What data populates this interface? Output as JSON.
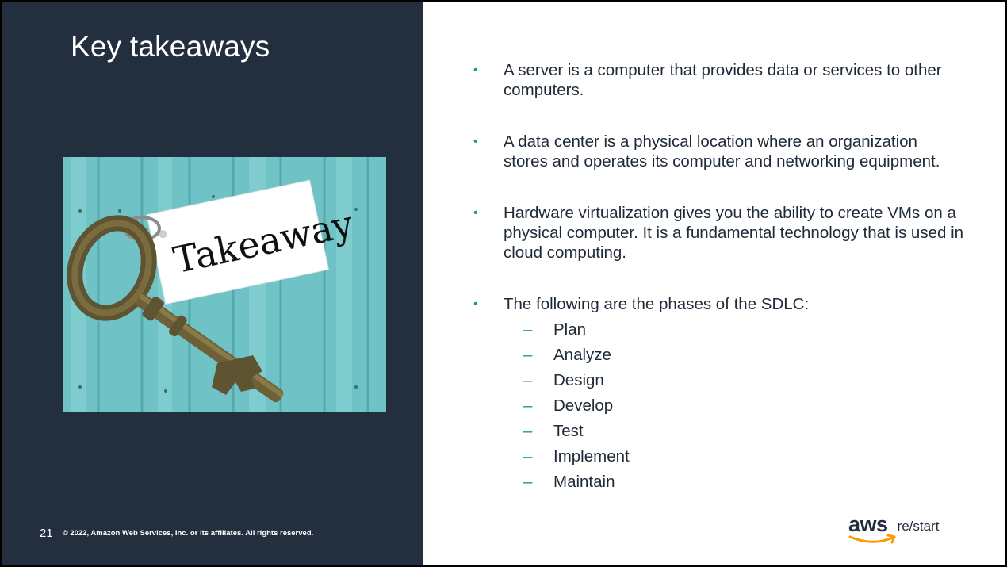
{
  "slide": {
    "title": "Key takeaways",
    "page_number": "21",
    "copyright": "© 2022, Amazon Web Services, Inc. or its affiliates. All rights reserved.",
    "image": {
      "tag_text": "Takeaway",
      "icon": "key-with-tag-image"
    }
  },
  "bullets": [
    {
      "text": "A server is a computer that provides data or services to other computers."
    },
    {
      "text": "A data center is a physical location where an organization stores and operates its computer and networking equipment."
    },
    {
      "text": "Hardware virtualization gives you the ability to create VMs on a physical computer. It is a fundamental technology that is used in cloud computing."
    },
    {
      "text": "The following are the phases of the SDLC:"
    }
  ],
  "bullet_marker": "•",
  "sub_marker": "–",
  "sdlc_phases": [
    "Plan",
    "Analyze",
    "Design",
    "Develop",
    "Test",
    "Implement",
    "Maintain"
  ],
  "logo": {
    "aws": "aws",
    "product": "re/start"
  },
  "colors": {
    "panel": "#232f3e",
    "accent": "#1a9c8b",
    "text": "#1f2a38",
    "aws_orange": "#ff9900"
  }
}
